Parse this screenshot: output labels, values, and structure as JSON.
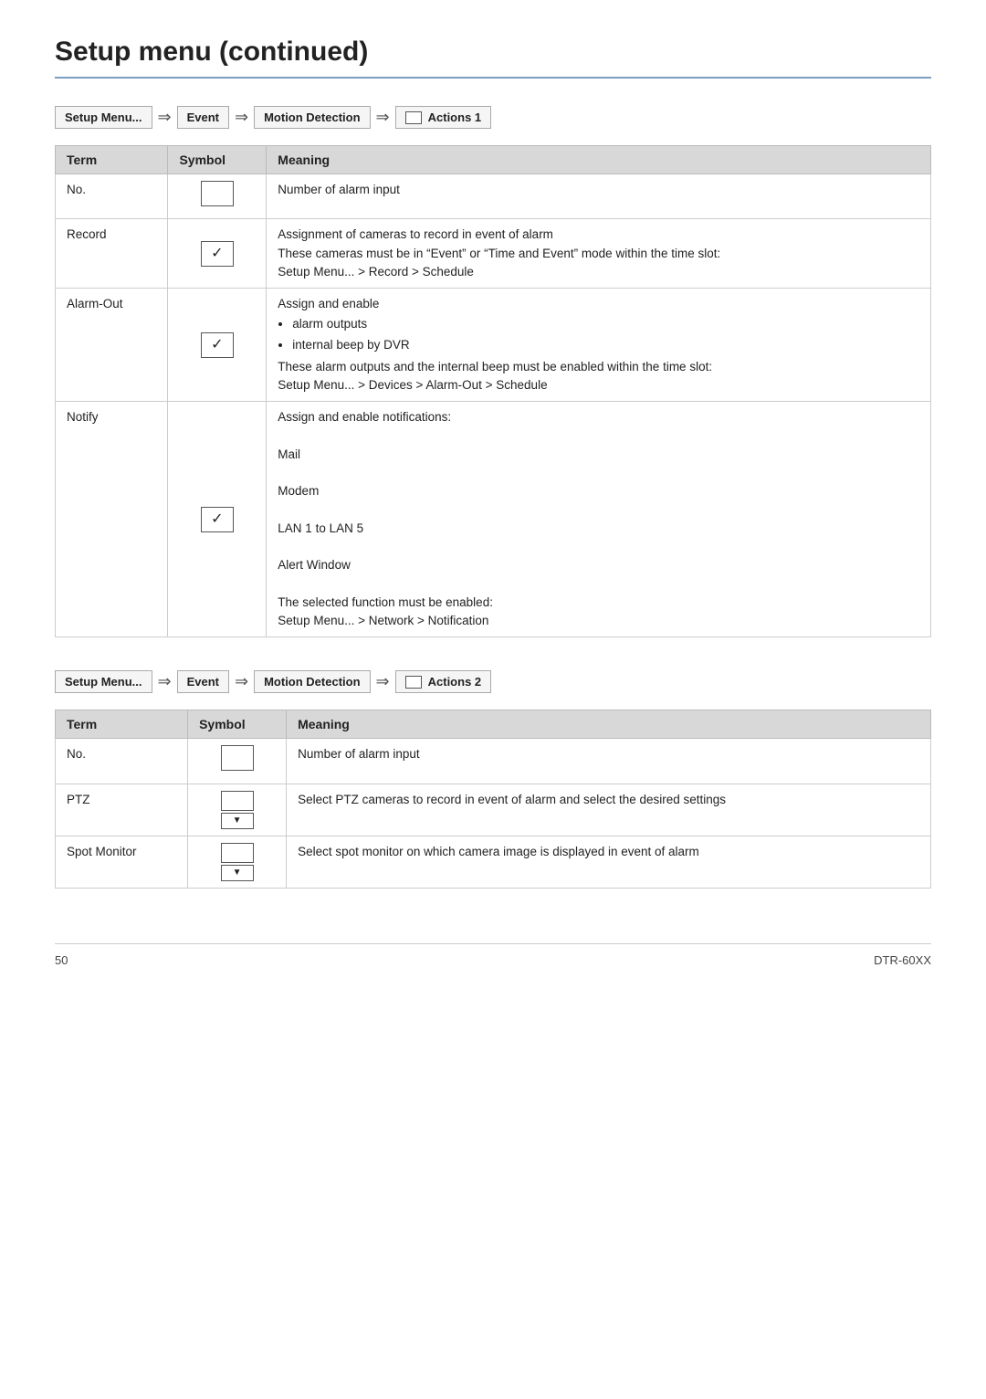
{
  "page": {
    "title": "Setup menu (continued)",
    "footer_page": "50",
    "footer_model": "DTR-60XX"
  },
  "section1": {
    "nav": {
      "setup_menu": "Setup Menu...",
      "event": "Event",
      "motion_detection": "Motion Detection",
      "actions": "Actions 1"
    },
    "table": {
      "headers": [
        "Term",
        "Symbol",
        "Meaning"
      ],
      "rows": [
        {
          "term": "No.",
          "symbol": "box",
          "meaning": "Number of alarm input"
        },
        {
          "term": "Record",
          "symbol": "checkbox",
          "meaning_lines": [
            "Assignment of cameras to record in event of alarm",
            "These cameras must be in \"Event\" or \"Time and Event\" mode within the time slot:",
            "Setup Menu... > Record > Schedule"
          ]
        },
        {
          "term": "Alarm-Out",
          "symbol": "checkbox",
          "meaning_lines": [
            "Assign and enable",
            "alarm outputs",
            "internal beep by DVR",
            "These alarm outputs and the internal beep must be enabled within the time slot:",
            "Setup Menu... > Devices > Alarm-Out > Schedule"
          ],
          "has_bullets": true,
          "bullets": [
            "alarm outputs",
            "internal beep by DVR"
          ]
        },
        {
          "term": "Notify",
          "symbol": "checkbox",
          "meaning_lines": [
            "Assign and enable notifications:",
            "Mail",
            "Modem",
            "LAN 1 to LAN 5",
            "Alert Window",
            "The selected function must be enabled:",
            "Setup Menu... > Network > Notification"
          ]
        }
      ]
    }
  },
  "section2": {
    "nav": {
      "setup_menu": "Setup Menu...",
      "event": "Event",
      "motion_detection": "Motion Detection",
      "actions": "Actions 2"
    },
    "table": {
      "headers": [
        "Term",
        "Symbol",
        "Meaning"
      ],
      "rows": [
        {
          "term": "No.",
          "symbol": "box",
          "meaning": "Number of alarm input"
        },
        {
          "term": "PTZ",
          "symbol": "dropdown",
          "meaning": "Select PTZ cameras to record in event of alarm and select the desired settings"
        },
        {
          "term": "Spot Monitor",
          "symbol": "dropdown",
          "meaning": "Select spot monitor on which camera image is displayed in event of alarm"
        }
      ]
    }
  }
}
